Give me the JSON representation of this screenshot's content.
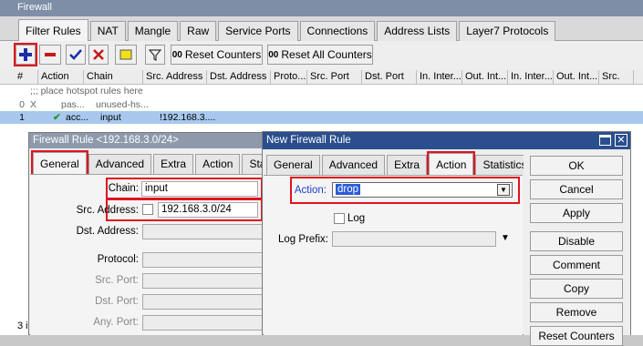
{
  "window_title": "Firewall",
  "tabs": [
    "Filter Rules",
    "NAT",
    "Mangle",
    "Raw",
    "Service Ports",
    "Connections",
    "Address Lists",
    "Layer7 Protocols"
  ],
  "toolbar": {
    "add_icon": "plus-icon",
    "remove_icon": "minus-icon",
    "enable_icon": "check-icon",
    "disable_icon": "x-icon",
    "comment_icon": "note-icon",
    "filter_icon": "funnel-icon",
    "reset_counters": "Reset Counters",
    "reset_all_counters": "Reset All Counters",
    "counter_badge": "00"
  },
  "columns": [
    "#",
    "Action",
    "Chain",
    "Src. Address",
    "Dst. Address",
    "Proto...",
    "Src. Port",
    "Dst. Port",
    "In. Inter...",
    "Out. Int...",
    "In. Inter...",
    "Out. Int...",
    "Src."
  ],
  "comment_row": ";;; place hotspot rules here",
  "rows": [
    {
      "num": "0",
      "flag": "X",
      "action": "pas...",
      "chain": "unused-hs...",
      "src": "",
      "selected": false
    },
    {
      "num": "1",
      "flag": "",
      "action": "acc...",
      "chain": "input",
      "src": "!192.168.3....",
      "selected": true
    }
  ],
  "status": "3 i",
  "rule_window": {
    "title": "Firewall Rule <192.168.3.0/24>",
    "tabs": [
      "General",
      "Advanced",
      "Extra",
      "Action",
      "Statistics"
    ],
    "chain_label": "Chain:",
    "chain_value": "input",
    "src_label": "Src. Address:",
    "src_value": "192.168.3.0/24",
    "dst_label": "Dst. Address:",
    "protocol_label": "Protocol:",
    "src_port_label": "Src. Port:",
    "dst_port_label": "Dst. Port:",
    "any_port_label": "Any. Port:"
  },
  "new_window": {
    "title": "New Firewall Rule",
    "tabs": [
      "General",
      "Advanced",
      "Extra",
      "Action",
      "Statistics"
    ],
    "action_label": "Action:",
    "action_value": "drop",
    "log_label": "Log",
    "log_prefix_label": "Log Prefix:",
    "buttons": [
      "OK",
      "Cancel",
      "Apply",
      "Disable",
      "Comment",
      "Copy",
      "Remove",
      "Reset Counters"
    ]
  },
  "colors": {
    "title_bar": "#7d8ea6",
    "selected_row": "#a8c8ee",
    "highlight": "#e0141e",
    "blue_text": "#1b3fc4"
  }
}
